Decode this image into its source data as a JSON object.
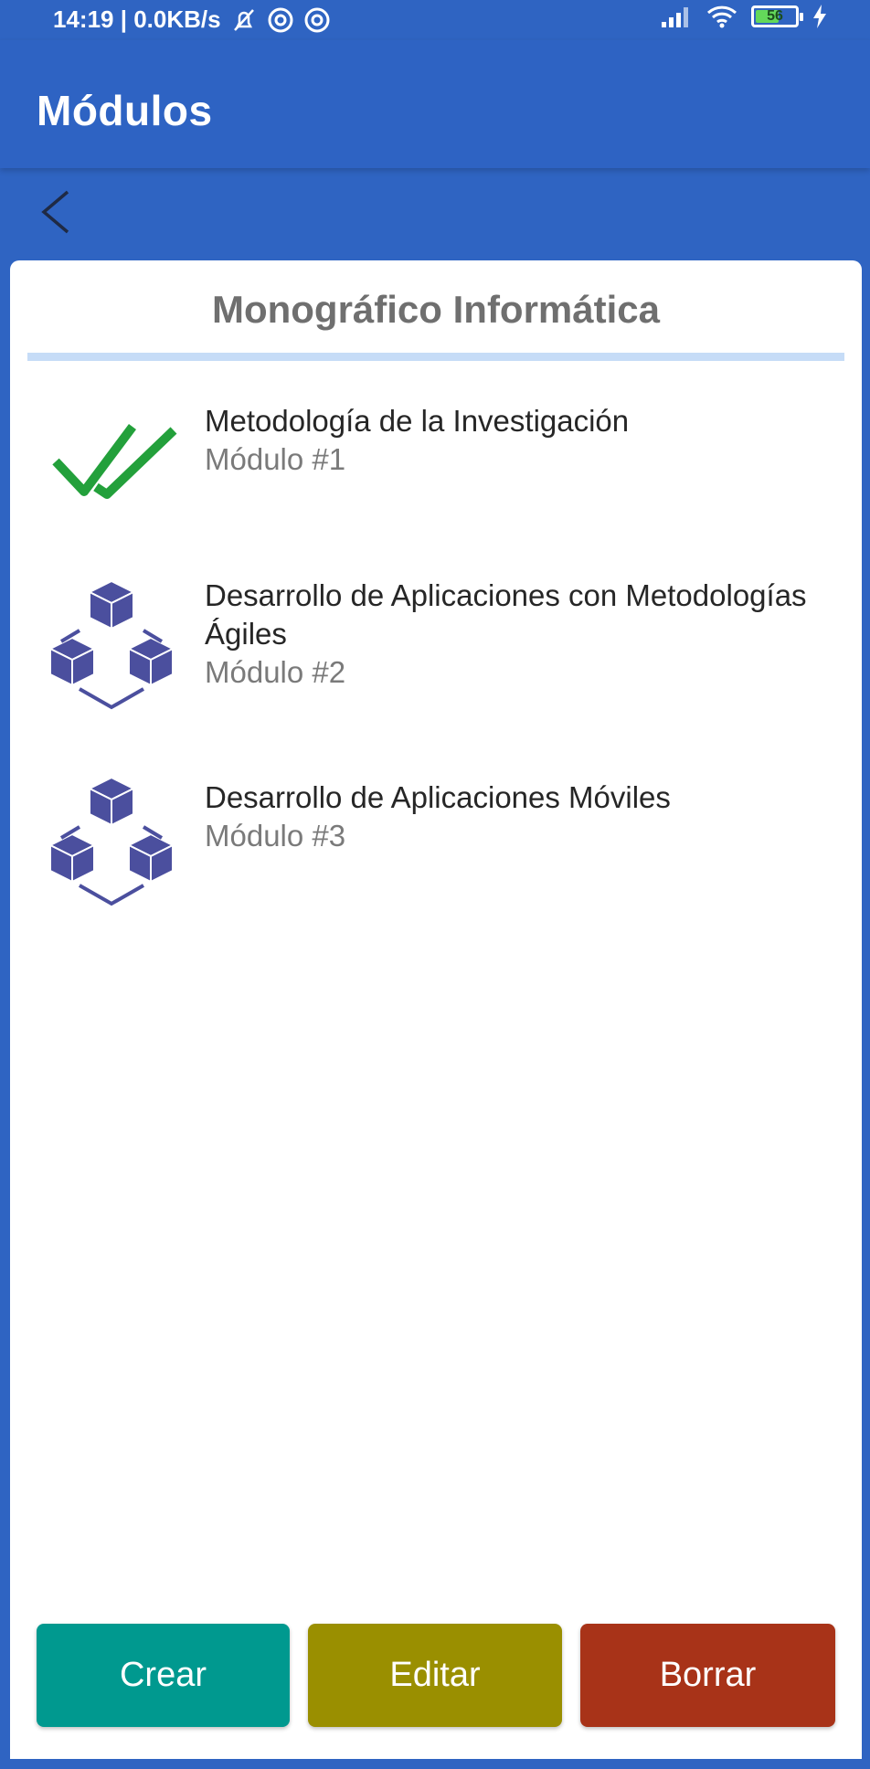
{
  "status_bar": {
    "time_speed": "14:19 | 0.0KB/s",
    "battery_level": "56"
  },
  "app_bar": {
    "title": "Módulos"
  },
  "card": {
    "title": "Monográfico Informática",
    "modules": [
      {
        "title": "Metodología de la Investigación",
        "subtitle": "Módulo #1",
        "icon": "check-icon"
      },
      {
        "title": "Desarrollo de Aplicaciones con Metodologías Ágiles",
        "subtitle": "Módulo #2",
        "icon": "cubes-icon"
      },
      {
        "title": "Desarrollo de Aplicaciones Móviles",
        "subtitle": "Módulo #3",
        "icon": "cubes-icon"
      }
    ]
  },
  "actions": {
    "create_label": "Crear",
    "edit_label": "Editar",
    "delete_label": "Borrar"
  },
  "colors": {
    "primary": "#2f64c2",
    "create": "#00998f",
    "edit": "#9a8f00",
    "delete": "#a83318",
    "check": "#23a03b",
    "cubes": "#4b4f9e"
  }
}
